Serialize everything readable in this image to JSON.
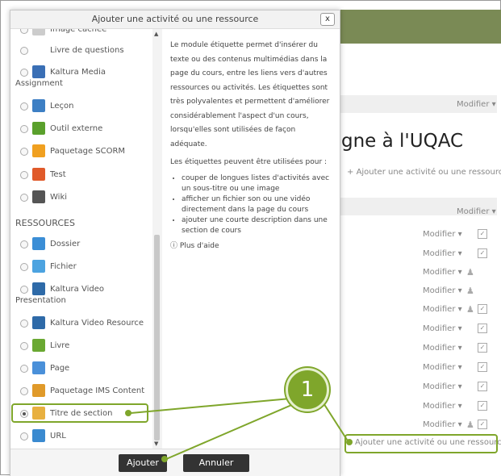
{
  "modal": {
    "title": "Ajouter une activité ou une ressource",
    "close": "x",
    "items_top": [
      {
        "label": "Image cachée",
        "icon": "hidden-image-icon",
        "color": "#cccccc"
      },
      {
        "label": "Livre de questions",
        "icon": "none",
        "color": "#ffffff"
      },
      {
        "label": "Kaltura Media",
        "label2": "Assignment",
        "icon": "kaltura-media-icon",
        "color": "#3a6fb5"
      },
      {
        "label": "Leçon",
        "icon": "lesson-icon",
        "color": "#3d7fc4"
      },
      {
        "label": "Outil externe",
        "icon": "puzzle-icon",
        "color": "#5aa02c"
      },
      {
        "label": "Paquetage SCORM",
        "icon": "scorm-icon",
        "color": "#f0a020"
      },
      {
        "label": "Test",
        "icon": "quiz-icon",
        "color": "#e05a2a"
      },
      {
        "label": "Wiki",
        "icon": "wiki-icon",
        "color": "#555555"
      }
    ],
    "resources_heading": "RESSOURCES",
    "items_resources": [
      {
        "label": "Dossier",
        "icon": "folder-icon",
        "color": "#3b8ed6"
      },
      {
        "label": "Fichier",
        "icon": "file-icon",
        "color": "#4ca3e0"
      },
      {
        "label": "Kaltura Video",
        "label2": "Presentation",
        "icon": "kaltura-video-icon",
        "color": "#2e6aa8"
      },
      {
        "label": "Kaltura Video Resource",
        "icon": "kaltura-resource-icon",
        "color": "#2e6aa8"
      },
      {
        "label": "Livre",
        "icon": "book-icon",
        "color": "#6aa832"
      },
      {
        "label": "Page",
        "icon": "page-icon",
        "color": "#4a90d9"
      },
      {
        "label": "Paquetage IMS Content",
        "icon": "ims-icon",
        "color": "#e09a2a"
      },
      {
        "label": "Titre de section",
        "icon": "tag-icon",
        "color": "#e8b040",
        "selected": true
      },
      {
        "label": "URL",
        "icon": "globe-icon",
        "color": "#3a8ad0"
      }
    ],
    "description": {
      "p1": "Le module étiquette permet d'insérer du texte ou des contenus multimédias dans la page du cours, entre les liens vers d'autres ressources ou activités. Les étiquettes sont très polyvalentes et permettent d'améliorer considérablement l'aspect d'un cours, lorsqu'elles sont utilisées de façon adéquate.",
      "p2": "Les étiquettes peuvent être utilisées pour :",
      "bullets": [
        "couper de longues listes d'activités avec un sous-titre ou une image",
        "afficher un fichier son ou une vidéo directement dans la page du cours",
        "ajouter une courte description dans une section de cours"
      ],
      "help": "Plus d'aide"
    },
    "buttons": {
      "add": "Ajouter",
      "cancel": "Annuler"
    }
  },
  "background": {
    "course_title": "gne à l'UQAC",
    "modifier": "Modifier",
    "modifier_short": "Modifier",
    "add_activity": "Ajouter une activité ou une ressource"
  },
  "callout_number": "1",
  "colors": {
    "accent": "#7fa62b",
    "topbar": "#7a8a55"
  }
}
